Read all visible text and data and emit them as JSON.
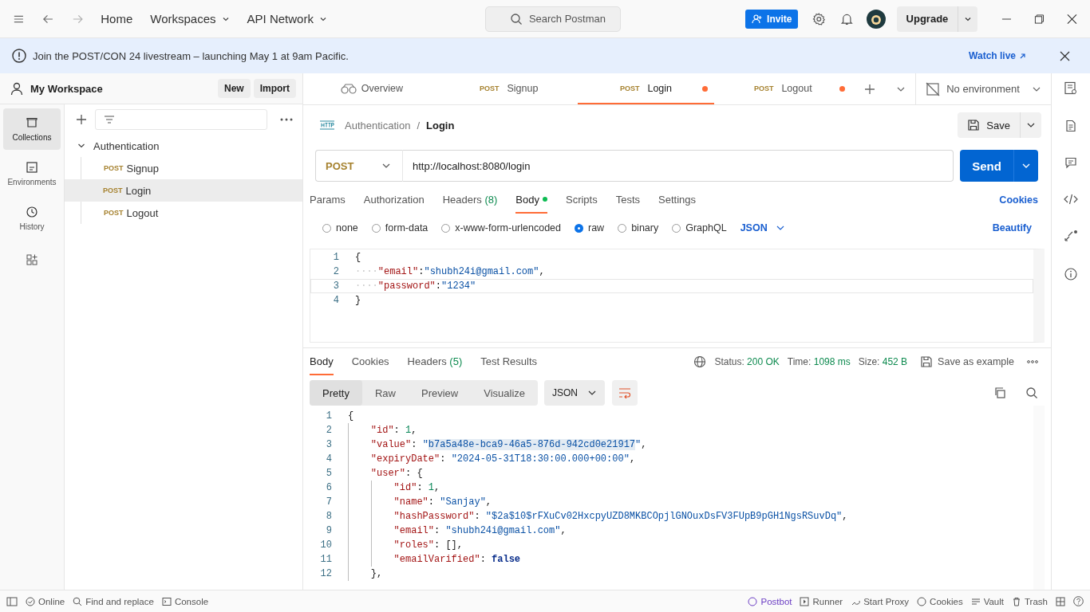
{
  "titlebar": {
    "nav": [
      {
        "label": "Home",
        "dropdown": false
      },
      {
        "label": "Workspaces",
        "dropdown": true
      },
      {
        "label": "API Network",
        "dropdown": true
      }
    ],
    "search": {
      "placeholder": "Search Postman"
    },
    "invite": "Invite",
    "upgrade": "Upgrade"
  },
  "banner": {
    "text": "Join the POST/CON 24 livestream – launching May 1 at 9am Pacific.",
    "link": "Watch live"
  },
  "workspace": {
    "name": "My Workspace",
    "buttons": [
      "New",
      "Import"
    ]
  },
  "rail": [
    {
      "label": "Collections",
      "selected": true
    },
    {
      "label": "Environments",
      "selected": false
    },
    {
      "label": "History",
      "selected": false
    }
  ],
  "tree": {
    "name": "Authentication",
    "expanded": true,
    "children": [
      {
        "method": "POST",
        "name": "Signup",
        "selected": false
      },
      {
        "method": "POST",
        "name": "Login",
        "selected": true
      },
      {
        "method": "POST",
        "name": "Logout",
        "selected": false
      }
    ]
  },
  "tabs": [
    {
      "kind": "overview",
      "label": "Overview",
      "selected": false,
      "unsaved": false
    },
    {
      "kind": "request",
      "method": "POST",
      "label": "Signup",
      "selected": false,
      "unsaved": false
    },
    {
      "kind": "request",
      "method": "POST",
      "label": "Login",
      "selected": true,
      "unsaved": true
    },
    {
      "kind": "request",
      "method": "POST",
      "label": "Logout",
      "selected": false,
      "unsaved": true
    }
  ],
  "environment": "No environment",
  "breadcrumb": {
    "parent": "Authentication",
    "separator": "/",
    "current": "Login"
  },
  "save": "Save",
  "request": {
    "method": "POST",
    "url": "http://localhost:8080/login",
    "send": "Send"
  },
  "request_tabs": [
    {
      "label": "Params",
      "selected": false,
      "dot": false
    },
    {
      "label": "Authorization",
      "selected": false,
      "dot": false
    },
    {
      "label": "Headers",
      "count": "(8)",
      "selected": false,
      "dot": false
    },
    {
      "label": "Body",
      "selected": true,
      "dot": true
    },
    {
      "label": "Scripts",
      "selected": false,
      "dot": false
    },
    {
      "label": "Tests",
      "selected": false,
      "dot": false
    },
    {
      "label": "Settings",
      "selected": false,
      "dot": false
    }
  ],
  "cookies_link": "Cookies",
  "body_types": [
    {
      "label": "none",
      "selected": false
    },
    {
      "label": "form-data",
      "selected": false
    },
    {
      "label": "x-www-form-urlencoded",
      "selected": false
    },
    {
      "label": "raw",
      "selected": true
    },
    {
      "label": "binary",
      "selected": false
    },
    {
      "label": "GraphQL",
      "selected": false
    }
  ],
  "body_format": "JSON",
  "beautify": "Beautify",
  "request_body": [
    {
      "num": "1",
      "active": false,
      "tokens": [
        {
          "kind": "punct",
          "text": "{"
        }
      ]
    },
    {
      "num": "2",
      "active": false,
      "tokens": [
        {
          "kind": "ws",
          "text": "····"
        },
        {
          "kind": "key",
          "text": "\"email\""
        },
        {
          "kind": "punct",
          "text": ":"
        },
        {
          "kind": "string",
          "text": "\"shubh24i@gmail.com\""
        },
        {
          "kind": "punct",
          "text": ","
        }
      ]
    },
    {
      "num": "3",
      "active": true,
      "tokens": [
        {
          "kind": "ws",
          "text": "····"
        },
        {
          "kind": "key",
          "text": "\"password\""
        },
        {
          "kind": "punct",
          "text": ":"
        },
        {
          "kind": "string",
          "text": "\"1234\""
        }
      ]
    },
    {
      "num": "4",
      "active": false,
      "tokens": [
        {
          "kind": "punct",
          "text": "}"
        }
      ]
    }
  ],
  "response": {
    "tabs": [
      {
        "label": "Body",
        "selected": true
      },
      {
        "label": "Cookies",
        "selected": false
      },
      {
        "label": "Headers",
        "count": "(5)",
        "selected": false
      },
      {
        "label": "Test Results",
        "selected": false
      }
    ],
    "stats": [
      {
        "label": "Status:",
        "value": "200 OK"
      },
      {
        "label": "Time:",
        "value": "1098 ms"
      },
      {
        "label": "Size:",
        "value": "452 B"
      }
    ],
    "save_example": "Save as example",
    "views": [
      {
        "label": "Pretty",
        "selected": true
      },
      {
        "label": "Raw",
        "selected": false
      },
      {
        "label": "Preview",
        "selected": false
      },
      {
        "label": "Visualize",
        "selected": false
      }
    ],
    "format": "JSON",
    "lines": [
      {
        "num": "1",
        "tokens": [
          {
            "kind": "punct",
            "text": "{"
          }
        ],
        "children": [
          {
            "num": "2",
            "tokens": [
              {
                "kind": "key",
                "text": "\"id\""
              },
              {
                "kind": "punct",
                "text": ": "
              },
              {
                "kind": "number",
                "text": "1"
              },
              {
                "kind": "punct",
                "text": ","
              }
            ]
          },
          {
            "num": "3",
            "tokens": [
              {
                "kind": "key",
                "text": "\"value\""
              },
              {
                "kind": "punct",
                "text": ": "
              },
              {
                "kind": "string",
                "text": "\""
              },
              {
                "kind": "highlight",
                "text": "b7a5a48e-bca9-46a5-876d-942cd0e21917"
              },
              {
                "kind": "string",
                "text": "\""
              },
              {
                "kind": "punct",
                "text": ","
              }
            ]
          },
          {
            "num": "4",
            "tokens": [
              {
                "kind": "key",
                "text": "\"expiryDate\""
              },
              {
                "kind": "punct",
                "text": ": "
              },
              {
                "kind": "string",
                "text": "\"2024-05-31T18:30:00.000+00:00\""
              },
              {
                "kind": "punct",
                "text": ","
              }
            ]
          },
          {
            "num": "5",
            "tokens": [
              {
                "kind": "key",
                "text": "\"user\""
              },
              {
                "kind": "punct",
                "text": ": {"
              }
            ],
            "children": [
              {
                "num": "6",
                "tokens": [
                  {
                    "kind": "key",
                    "text": "\"id\""
                  },
                  {
                    "kind": "punct",
                    "text": ": "
                  },
                  {
                    "kind": "number",
                    "text": "1"
                  },
                  {
                    "kind": "punct",
                    "text": ","
                  }
                ]
              },
              {
                "num": "7",
                "tokens": [
                  {
                    "kind": "key",
                    "text": "\"name\""
                  },
                  {
                    "kind": "punct",
                    "text": ": "
                  },
                  {
                    "kind": "string",
                    "text": "\"Sanjay\""
                  },
                  {
                    "kind": "punct",
                    "text": ","
                  }
                ]
              },
              {
                "num": "8",
                "tokens": [
                  {
                    "kind": "key",
                    "text": "\"hashPassword\""
                  },
                  {
                    "kind": "punct",
                    "text": ": "
                  },
                  {
                    "kind": "string",
                    "text": "\"$2a$10$rFXuCv02HxcpyUZD8MKBCOpjlGNOuxDsFV3FUpB9pGH1NgsRSuvDq\""
                  },
                  {
                    "kind": "punct",
                    "text": ","
                  }
                ]
              },
              {
                "num": "9",
                "tokens": [
                  {
                    "kind": "key",
                    "text": "\"email\""
                  },
                  {
                    "kind": "punct",
                    "text": ": "
                  },
                  {
                    "kind": "string",
                    "text": "\"shubh24i@gmail.com\""
                  },
                  {
                    "kind": "punct",
                    "text": ","
                  }
                ]
              },
              {
                "num": "10",
                "tokens": [
                  {
                    "kind": "key",
                    "text": "\"roles\""
                  },
                  {
                    "kind": "punct",
                    "text": ": [],"
                  }
                ]
              },
              {
                "num": "11",
                "tokens": [
                  {
                    "kind": "key",
                    "text": "\"emailVarified\""
                  },
                  {
                    "kind": "punct",
                    "text": ": "
                  },
                  {
                    "kind": "keyword",
                    "text": "false"
                  }
                ]
              }
            ]
          },
          {
            "num": "12",
            "tokens": [
              {
                "kind": "punct",
                "text": "},"
              }
            ]
          }
        ]
      }
    ]
  },
  "status_bar": {
    "left": [
      "Online",
      "Find and replace",
      "Console"
    ],
    "right": [
      {
        "label": "Postbot",
        "kind": "accent"
      },
      {
        "label": "Runner",
        "kind": "plain"
      },
      {
        "label": "Start Proxy",
        "kind": "plain"
      },
      {
        "label": "Cookies",
        "kind": "plain"
      },
      {
        "label": "Vault",
        "kind": "plain"
      },
      {
        "label": "Trash",
        "kind": "plain"
      }
    ]
  }
}
